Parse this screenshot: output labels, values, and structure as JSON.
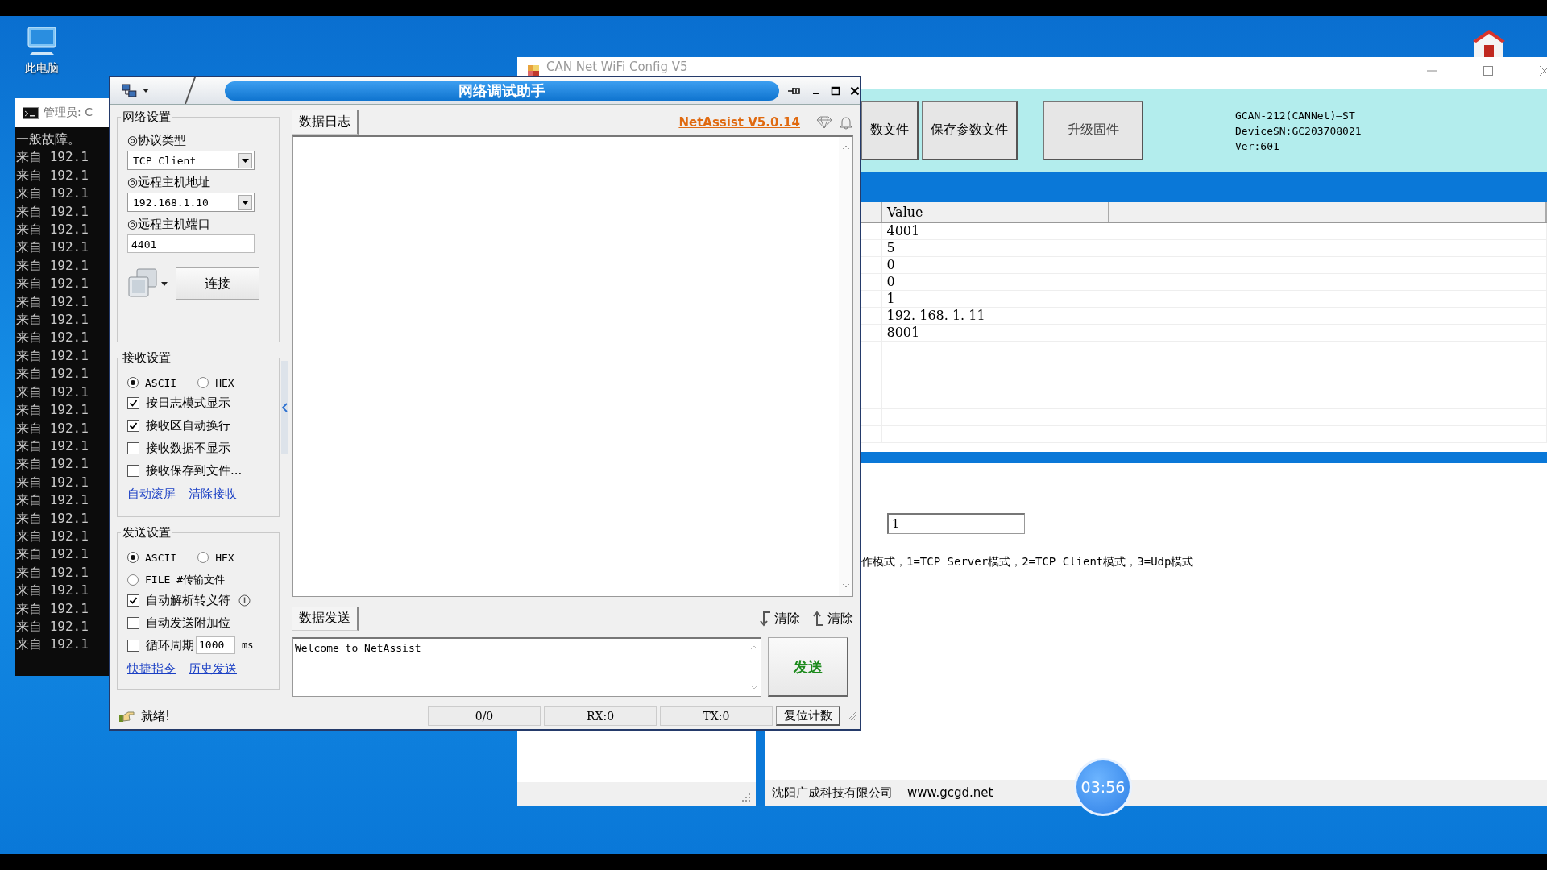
{
  "desktop": {
    "icons": [
      {
        "label": "此电脑"
      }
    ],
    "timer": "03:56"
  },
  "cmd_window": {
    "title": "管理员: C",
    "lines": [
      "一般故障。",
      "来自 192.1",
      "来自 192.1",
      "来自 192.1",
      "来自 192.1",
      "来自 192.1",
      "来自 192.1",
      "来自 192.1",
      "来自 192.1",
      "来自 192.1",
      "来自 192.1",
      "来自 192.1",
      "来自 192.1",
      "来自 192.1",
      "来自 192.1",
      "来自 192.1",
      "来自 192.1",
      "来自 192.1",
      "来自 192.1",
      "来自 192.1",
      "来自 192.1",
      "来自 192.1",
      "来自 192.1",
      "来自 192.1",
      "来自 192.1",
      "来自 192.1",
      "来自 192.1",
      "来自 192.1",
      "来自 192.1"
    ]
  },
  "config_window": {
    "title": "CAN Net WiFi Config V5",
    "toolbar_buttons": [
      "数文件",
      "保存参数文件",
      "升级固件"
    ],
    "device_info": [
      "GCAN-212(CANNet)—ST",
      "DeviceSN:GC203708021",
      "Ver:601"
    ],
    "table": {
      "columns": [
        "Value"
      ],
      "rows": [
        "4001",
        "5",
        "0",
        "0",
        "1",
        "192. 168. 1. 11",
        "8001"
      ]
    },
    "mode_field": {
      "value": "1"
    },
    "mode_hint": "作模式，1=TCP Server模式，2=TCP Client模式，3=Udp模式",
    "status_bar": [
      "沈阳广成科技有限公司",
      "www.gcgd.net"
    ]
  },
  "netassist": {
    "title": "网络调试助手",
    "network_settings": {
      "title": "网络设置",
      "fields": [
        {
          "label": "◎协议类型",
          "kind": "select",
          "value": "TCP Client"
        },
        {
          "label": "◎远程主机地址",
          "kind": "select",
          "value": "192.168.1.10"
        },
        {
          "label": "◎远程主机端口",
          "kind": "input",
          "value": "4401"
        }
      ],
      "connect_button": "连接"
    },
    "receive_settings": {
      "title": "接收设置",
      "encodings": [
        {
          "label": "ASCII",
          "selected": true
        },
        {
          "label": "HEX",
          "selected": false
        }
      ],
      "options": [
        {
          "label": "按日志模式显示",
          "checked": true
        },
        {
          "label": "接收区自动换行",
          "checked": true
        },
        {
          "label": "接收数据不显示",
          "checked": false
        },
        {
          "label": "接收保存到文件...",
          "checked": false
        }
      ],
      "links": [
        "自动滚屏",
        "清除接收"
      ]
    },
    "send_settings": {
      "title": "发送设置",
      "modes": [
        {
          "label": "ASCII",
          "selected": true
        },
        {
          "label": "HEX",
          "selected": false
        },
        {
          "label": "FILE #传输文件",
          "selected": false
        }
      ],
      "options": [
        {
          "label": "自动解析转义符",
          "checked": true,
          "kind": "info"
        },
        {
          "label": "自动发送附加位",
          "checked": false,
          "kind": "plain"
        },
        {
          "label": "循环周期",
          "checked": false,
          "kind": "period",
          "value": "1000",
          "unit": "ms"
        }
      ],
      "links": [
        "快捷指令",
        "历史发送"
      ]
    },
    "receive_tab": "数据日志",
    "version": "NetAssist V5.0.14",
    "send_tab": "数据发送",
    "clear_buttons": [
      "清除",
      "清除"
    ],
    "send_text": "Welcome to NetAssist",
    "send_button": "发送",
    "status": "就绪!",
    "counters": [
      "0/0",
      "RX:0",
      "TX:0"
    ],
    "reset_button": "复位计数"
  }
}
